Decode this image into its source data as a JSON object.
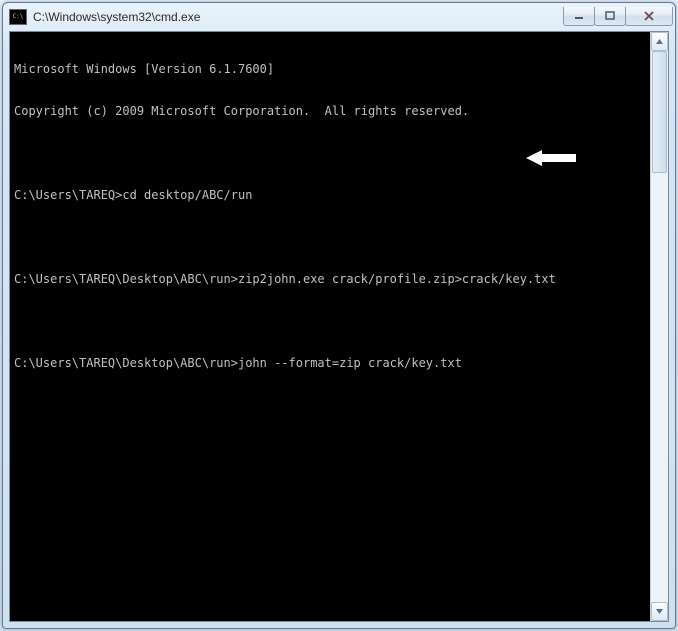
{
  "window": {
    "title": "C:\\Windows\\system32\\cmd.exe"
  },
  "terminal": {
    "lines": [
      "Microsoft Windows [Version 6.1.7600]",
      "Copyright (c) 2009 Microsoft Corporation.  All rights reserved.",
      "",
      "C:\\Users\\TAREQ>cd desktop/ABC/run",
      "",
      "C:\\Users\\TAREQ\\Desktop\\ABC\\run>zip2john.exe crack/profile.zip>crack/key.txt",
      "",
      "C:\\Users\\TAREQ\\Desktop\\ABC\\run>john --format=zip crack/key.txt"
    ]
  },
  "icons": {
    "minimize": "minimize-icon",
    "maximize": "maximize-icon",
    "close": "close-icon",
    "scroll_up": "chevron-up-icon",
    "scroll_down": "chevron-down-icon"
  }
}
